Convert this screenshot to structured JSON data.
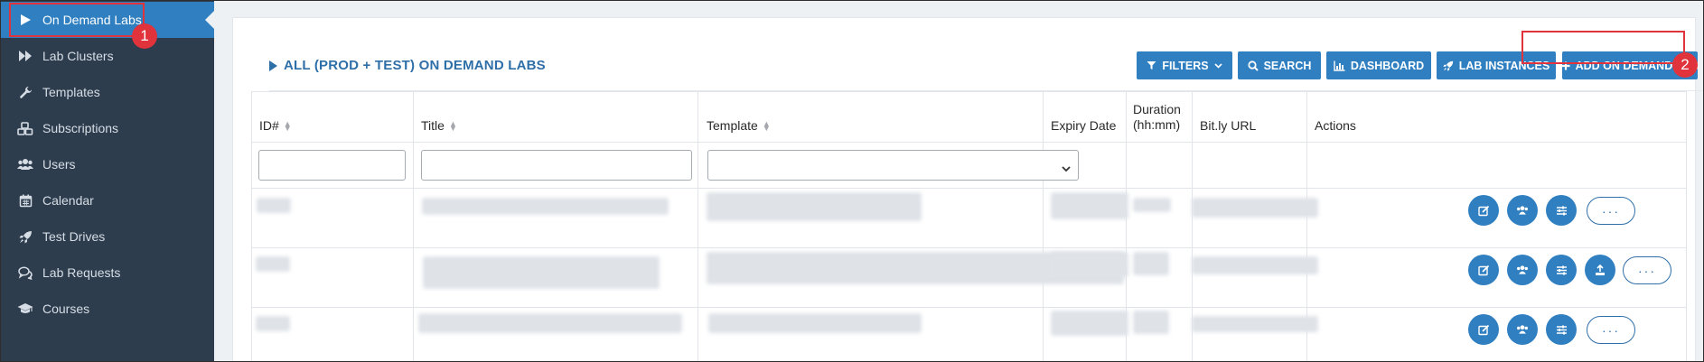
{
  "sidebar": {
    "items": [
      {
        "label": "On Demand Labs",
        "icon": "play-icon",
        "active": true
      },
      {
        "label": "Lab Clusters",
        "icon": "fast-forward-icon"
      },
      {
        "label": "Templates",
        "icon": "wrench-icon"
      },
      {
        "label": "Subscriptions",
        "icon": "cubes-icon"
      },
      {
        "label": "Users",
        "icon": "users-icon"
      },
      {
        "label": "Calendar",
        "icon": "calendar-icon"
      },
      {
        "label": "Test Drives",
        "icon": "rocket-icon"
      },
      {
        "label": "Lab Requests",
        "icon": "chat-bubbles-icon"
      },
      {
        "label": "Courses",
        "icon": "graduation-cap-icon"
      }
    ]
  },
  "header": {
    "title": "ALL (PROD + TEST) ON DEMAND LABS",
    "buttons": {
      "filters": "FILTERS",
      "search": "SEARCH",
      "dashboard": "DASHBOARD",
      "lab_instances": "LAB INSTANCES",
      "add_lab": "ADD ON DEMAND LAB"
    }
  },
  "table": {
    "columns": {
      "id": "ID#",
      "title": "Title",
      "template": "Template",
      "expiry": "Expiry Date",
      "duration_line1": "Duration",
      "duration_line2": "(hh:mm)",
      "bitly": "Bit.ly URL",
      "actions": "Actions"
    },
    "filters": {
      "id": "",
      "title": "",
      "template": ""
    },
    "rows": [
      {
        "redacted": true,
        "actions": [
          "edit-icon",
          "users-icon",
          "sliders-icon"
        ],
        "more": "···"
      },
      {
        "redacted": true,
        "actions": [
          "edit-icon",
          "users-icon",
          "sliders-icon",
          "upload-icon"
        ],
        "more": "···"
      },
      {
        "redacted": true,
        "actions": [
          "edit-icon",
          "users-icon",
          "sliders-icon"
        ],
        "more": "···"
      }
    ]
  },
  "annotations": {
    "step1": "1",
    "step2": "2"
  },
  "colors": {
    "accent": "#2f7fc1",
    "sidebar": "#2e3d4e",
    "highlight": "#e0333c",
    "title": "#2f6fa8"
  }
}
